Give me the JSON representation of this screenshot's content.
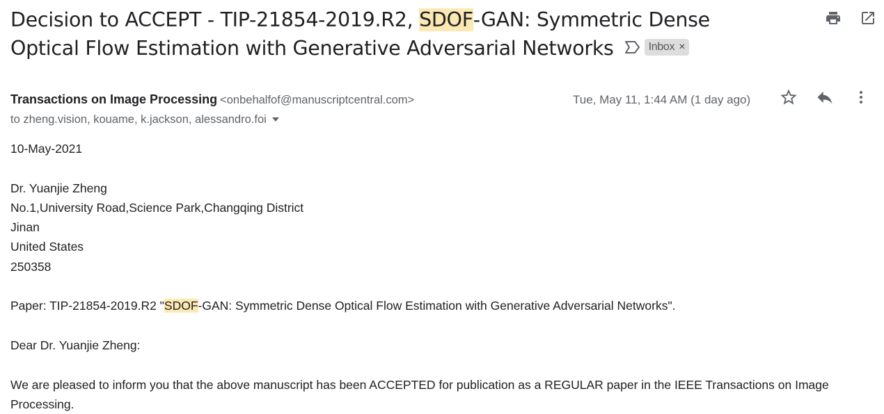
{
  "subject": {
    "prefix": "Decision to ACCEPT - TIP-21854-2019.R2, ",
    "highlight": "SDOF",
    "suffix": "-GAN: Symmetric Dense Optical Flow Estimation with Generative Adversarial Networks",
    "label": "Inbox",
    "label_remove": "×"
  },
  "header_icons": {
    "print": "printer-icon",
    "open": "open-in-new-window-icon"
  },
  "message": {
    "sender_name": "Transactions on Image Processing",
    "sender_email": "<onbehalfof@manuscriptcentral.com>",
    "date": "Tue, May 11, 1:44 AM (1 day ago)",
    "to": "to zheng.vision, kouame, k.jackson, alessandro.foi"
  },
  "body": {
    "date_line": "10-May-2021",
    "address": [
      "Dr. Yuanjie Zheng",
      "No.1,University Road,Science Park,Changqing District",
      "Jinan",
      "United States",
      "250358"
    ],
    "paper_prefix": "Paper: TIP-21854-2019.R2 \"",
    "paper_highlight": "SDOF",
    "paper_suffix": "-GAN: Symmetric Dense Optical Flow Estimation with Generative Adversarial Networks\".",
    "salutation": "Dear Dr. Yuanjie Zheng:",
    "paragraph": "We are pleased to inform you that the above manuscript has been ACCEPTED for publication as a REGULAR paper in the IEEE Transactions on Image Processing."
  },
  "colors": {
    "highlight": "#fce8b2",
    "text": "#202124",
    "muted": "#5f6368",
    "chip": "#dddddd"
  }
}
